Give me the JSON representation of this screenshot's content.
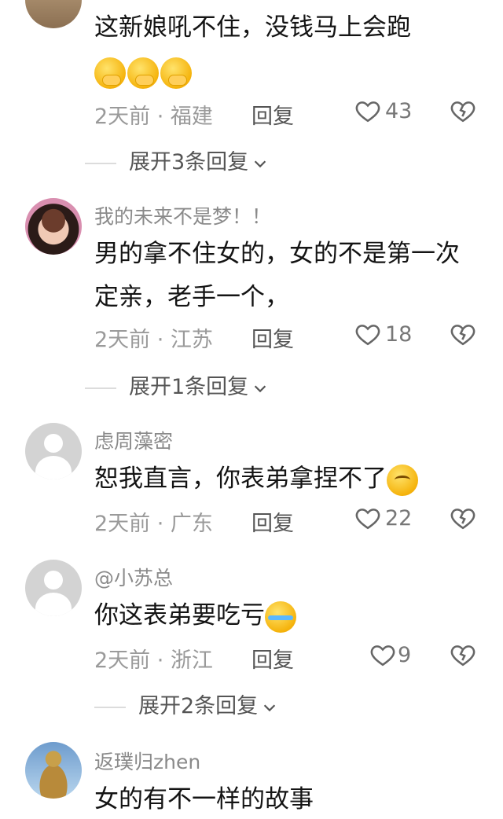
{
  "comments": [
    {
      "username": "",
      "text": "这新娘吼不住，没钱马上会跑",
      "emojis": [
        "hand-over-mouth-icon",
        "hand-over-mouth-icon",
        "hand-over-mouth-icon"
      ],
      "time_location": "2天前 · 福建",
      "reply_label": "回复",
      "likes": "43",
      "expand_label": "展开3条回复"
    },
    {
      "username": "我的未来不是梦！！",
      "text": "男的拿不住女的，女的不是第一次定亲，老手一个，",
      "time_location": "2天前 · 江苏",
      "reply_label": "回复",
      "likes": "18",
      "expand_label": "展开1条回复"
    },
    {
      "username": "虑周藻密",
      "text": "恕我直言，你表弟拿捏不了",
      "emojis": [
        "sad-face-icon"
      ],
      "time_location": "2天前 · 广东",
      "reply_label": "回复",
      "likes": "22"
    },
    {
      "username": "@小苏总",
      "text": "你这表弟要吃亏",
      "emojis": [
        "tears-of-joy-icon"
      ],
      "time_location": "2天前 · 浙江",
      "reply_label": "回复",
      "likes": "9",
      "expand_label": "展开2条回复"
    },
    {
      "username": "返璞归zhen",
      "text": "女的有不一样的故事"
    }
  ]
}
